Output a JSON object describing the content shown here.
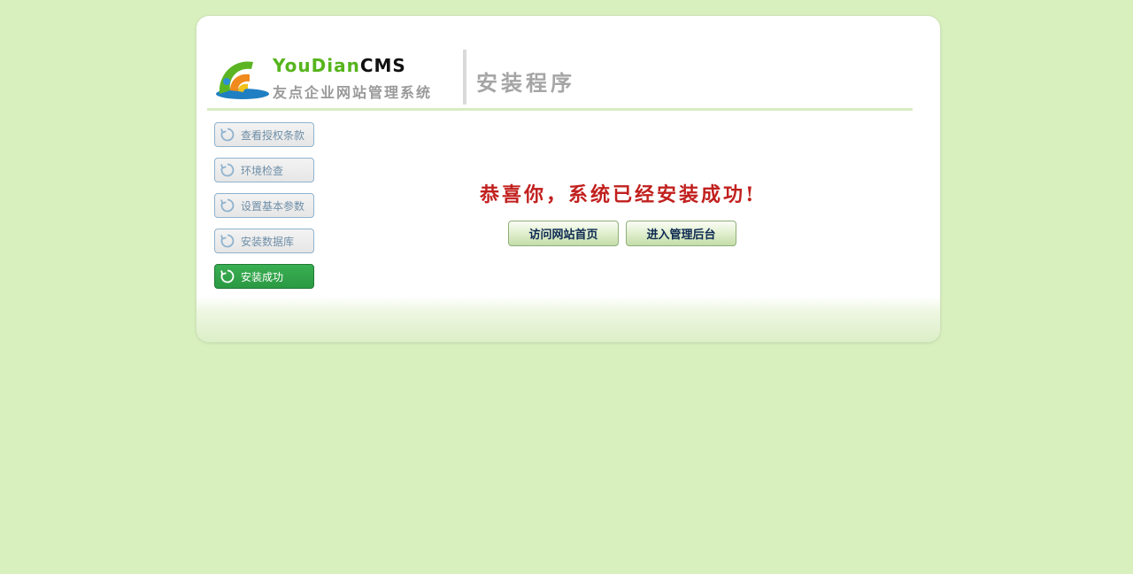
{
  "logo": {
    "word_green": "YouDian",
    "word_black": "CMS",
    "subtitle": "友点企业网站管理系统"
  },
  "page_title": "安装程序",
  "steps": [
    {
      "label": "查看授权条款",
      "active": false
    },
    {
      "label": "环境检查",
      "active": false
    },
    {
      "label": "设置基本参数",
      "active": false
    },
    {
      "label": "安装数据库",
      "active": false
    },
    {
      "label": "安装成功",
      "active": true
    }
  ],
  "main": {
    "success_message": "恭喜你，系统已经安装成功!",
    "buttons": {
      "visit_home": "访问网站首页",
      "enter_admin": "进入管理后台"
    }
  },
  "colors": {
    "page_bg": "#d8efbe",
    "active_step": "#2f9f47",
    "message": "#c1201e",
    "logo_green": "#56b41c"
  }
}
